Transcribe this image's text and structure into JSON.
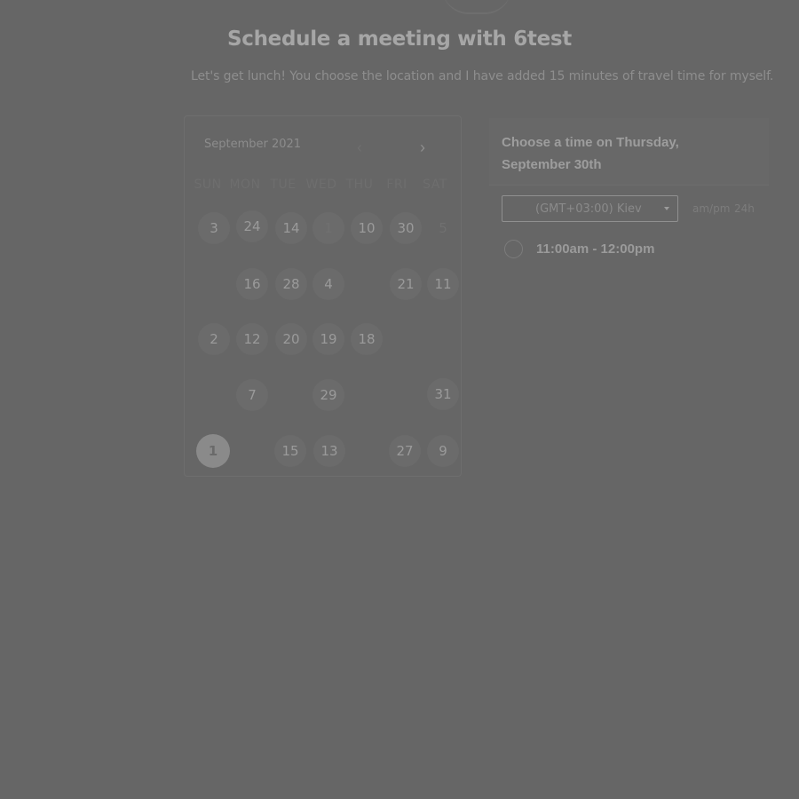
{
  "header": {
    "title": "Schedule a meeting with 6test",
    "subtitle": "Let's get lunch! You choose the location and I have added 15 minutes of travel time for myself."
  },
  "calendar": {
    "month_label": "September 2021",
    "prev_icon": "chevron-left-icon",
    "next_icon": "chevron-right-icon",
    "prev_glyph": "‹",
    "next_glyph": "›",
    "weekdays": [
      "SUN",
      "MON",
      "TUE",
      "WED",
      "THU",
      "FRI",
      "SAT"
    ],
    "rows": [
      [
        "3",
        "24",
        "14",
        "1",
        "10",
        "30",
        "5"
      ],
      [
        "",
        "16",
        "28",
        "4",
        "",
        "21",
        "11"
      ],
      [
        "2",
        "12",
        "20",
        "19",
        "18",
        "",
        ""
      ],
      [
        "",
        "7",
        "",
        "29",
        "",
        "",
        "31"
      ],
      [
        "1",
        "",
        "15",
        "13",
        "",
        "27",
        "9"
      ]
    ],
    "selected_day": "1"
  },
  "time_panel": {
    "heading": "Choose a time on Thursday, September 30th",
    "timezone": "(GMT+03:00) Kiev",
    "format_ampm": "am/pm",
    "format_24h": "24h",
    "slots": [
      {
        "label": "11:00am - 12:00pm"
      }
    ]
  },
  "colors": {
    "background": "#666666",
    "title": "#a6a6a6",
    "selected_day_bg": "#8a8a8a"
  }
}
